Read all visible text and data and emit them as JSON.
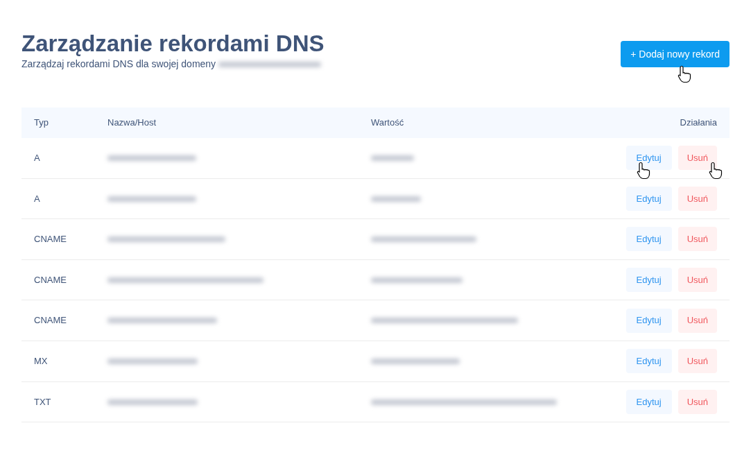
{
  "header": {
    "title": "Zarządzanie rekordami DNS",
    "subtitle": "Zarządzaj rekordami DNS dla swojej domeny"
  },
  "add_button": {
    "label": "+ Dodaj nowy rekord"
  },
  "table": {
    "columns": [
      "Typ",
      "Nazwa/Host",
      "Wartość",
      "Działania"
    ],
    "rows": [
      {
        "type": "A",
        "actions": [
          "Edytuj",
          "Usuń"
        ]
      },
      {
        "type": "A",
        "actions": [
          "Edytuj",
          "Usuń"
        ]
      },
      {
        "type": "CNAME",
        "actions": [
          "Edytuj",
          "Usuń"
        ]
      },
      {
        "type": "CNAME",
        "actions": [
          "Edytuj",
          "Usuń"
        ]
      },
      {
        "type": "CNAME",
        "actions": [
          "Edytuj",
          "Usuń"
        ]
      },
      {
        "type": "MX",
        "actions": [
          "Edytuj",
          "Usuń"
        ]
      },
      {
        "type": "TXT",
        "actions": [
          "Edytuj",
          "Usuń"
        ]
      }
    ]
  }
}
